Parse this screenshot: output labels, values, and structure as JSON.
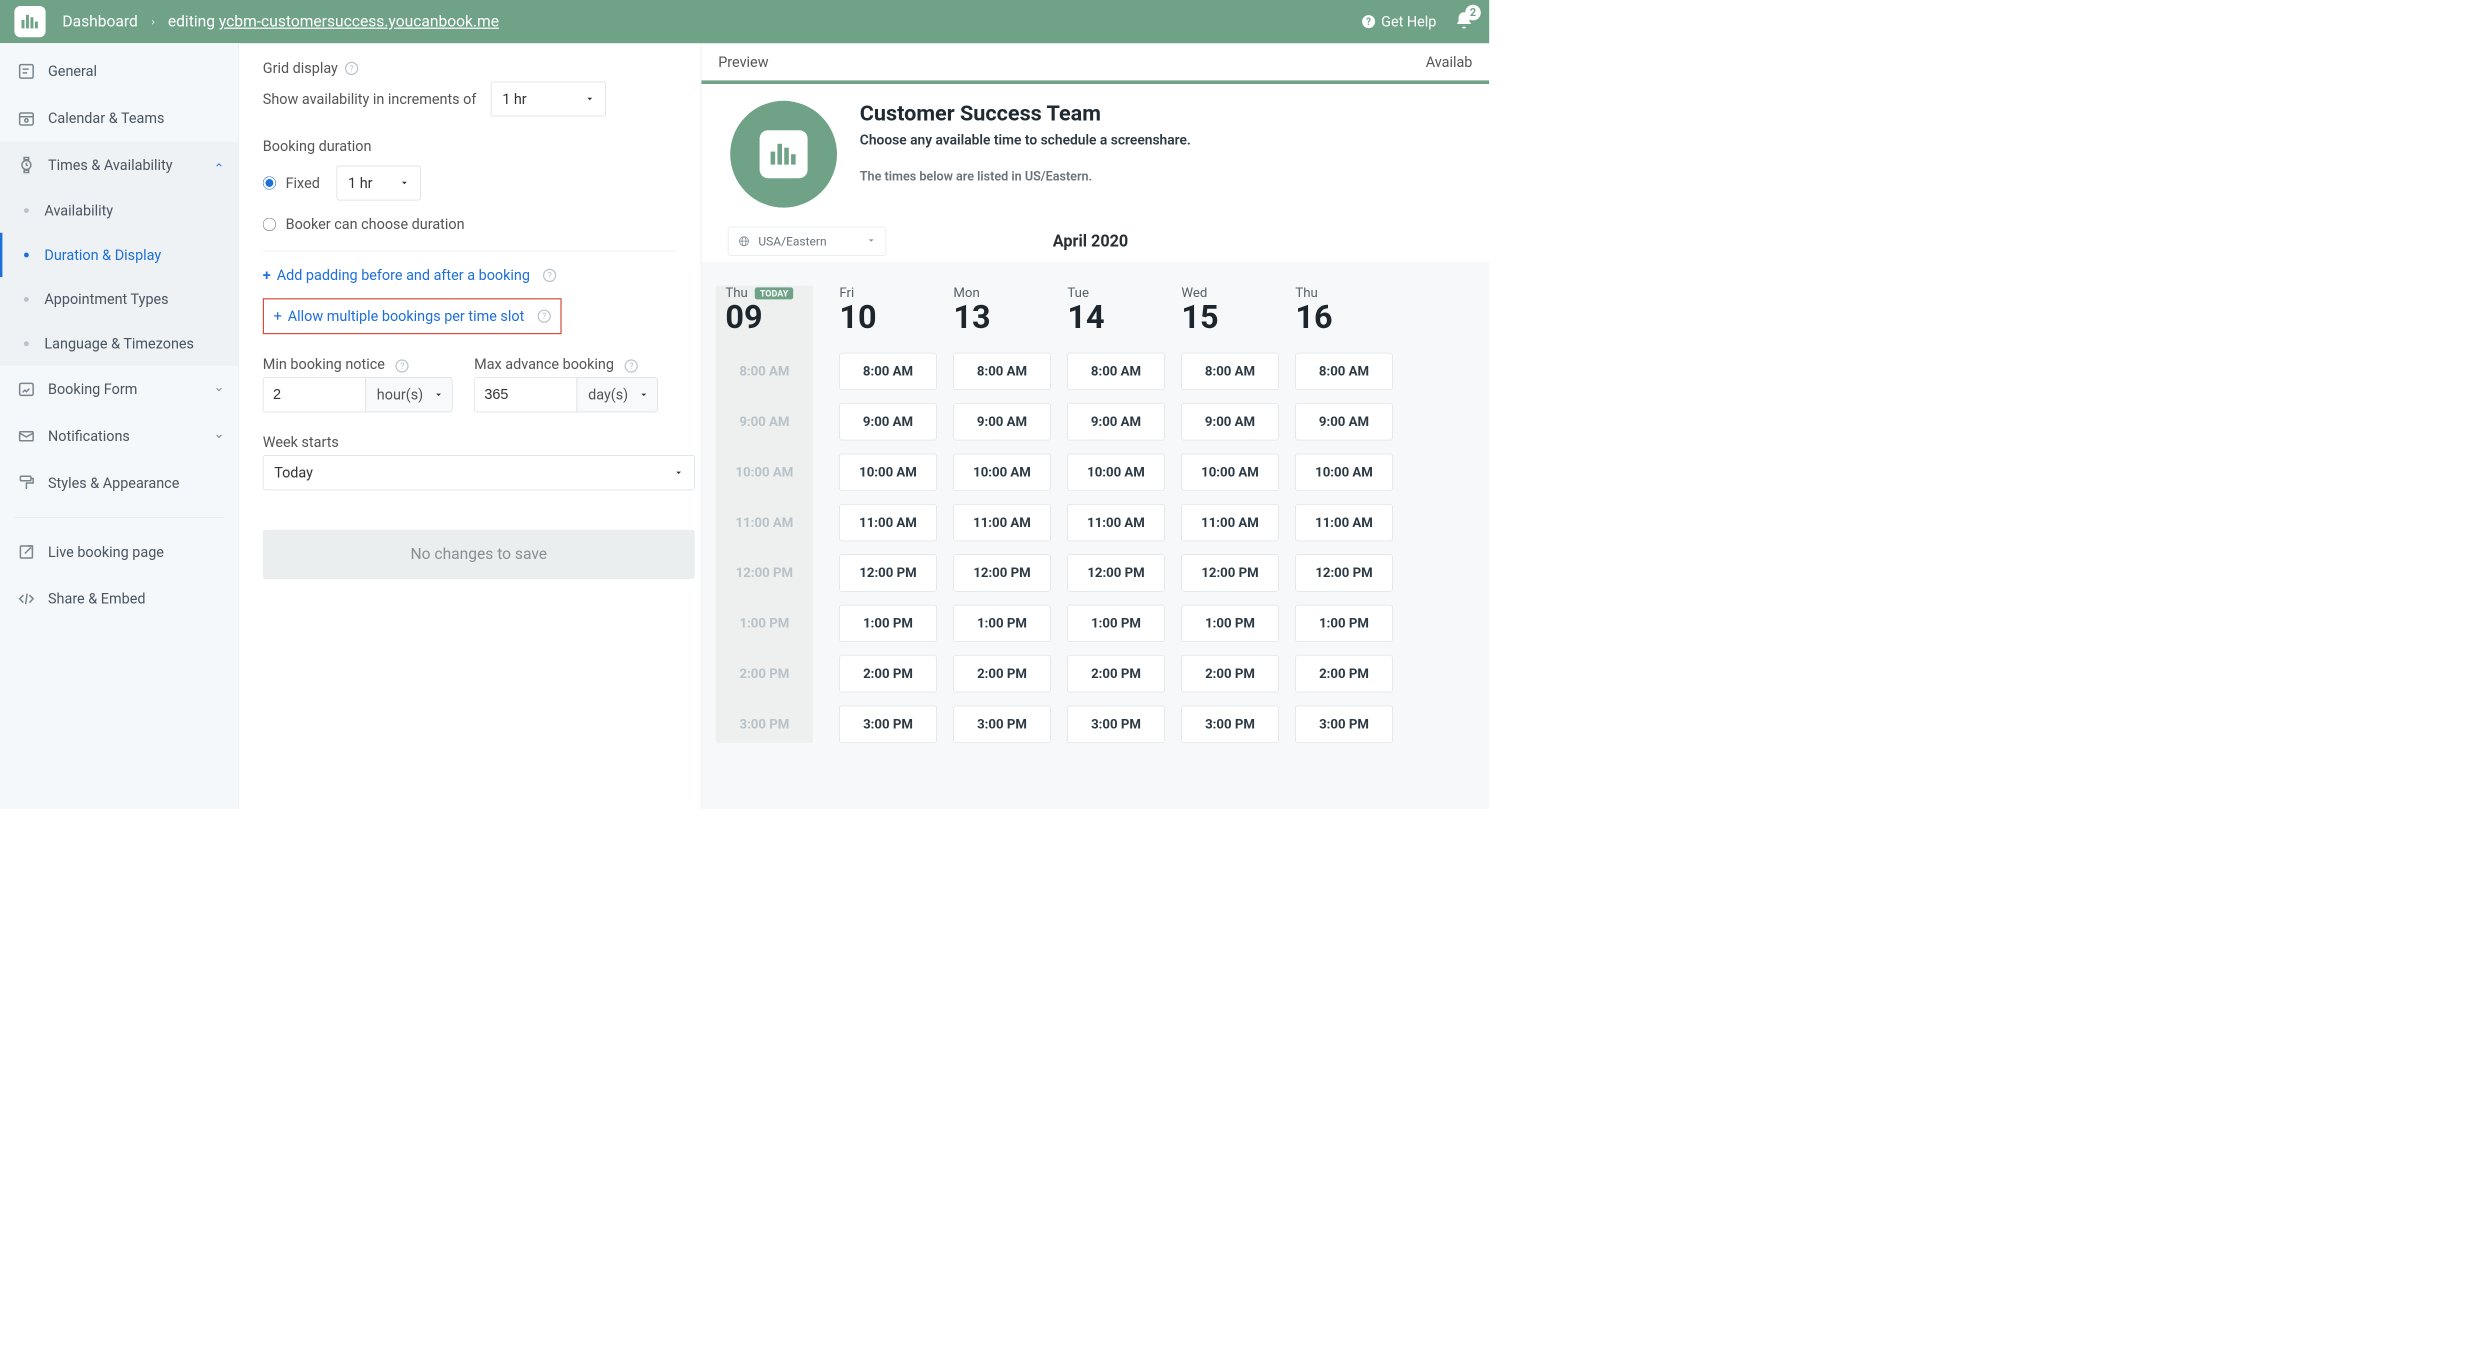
{
  "topbar": {
    "dashboard_label": "Dashboard",
    "editing_prefix": "editing ",
    "editing_url": "ycbm-customersuccess.youcanbook.me",
    "help_label": "Get Help",
    "notif_count": "2"
  },
  "sidebar": {
    "general": "General",
    "calendar_teams": "Calendar & Teams",
    "times_avail": "Times & Availability",
    "sub_availability": "Availability",
    "sub_duration": "Duration & Display",
    "sub_appt_types": "Appointment Types",
    "sub_lang_tz": "Language & Timezones",
    "booking_form": "Booking Form",
    "notifications": "Notifications",
    "styles": "Styles & Appearance",
    "live_page": "Live booking page",
    "share_embed": "Share & Embed"
  },
  "settings": {
    "grid_display": "Grid display",
    "show_incr_label": "Show availability in increments of",
    "show_incr_value": "1 hr",
    "booking_duration": "Booking duration",
    "fixed_label": "Fixed",
    "fixed_value": "1 hr",
    "booker_choose": "Booker can choose duration",
    "padding_link": "Add padding before and after a booking",
    "multi_link": "Allow multiple bookings per time slot",
    "min_notice_label": "Min booking notice",
    "min_notice_value": "2",
    "min_notice_unit": "hour(s)",
    "max_adv_label": "Max advance booking",
    "max_adv_value": "365",
    "max_adv_unit": "day(s)",
    "week_starts_label": "Week starts",
    "week_starts_value": "Today",
    "save_btn": "No changes to save"
  },
  "preview": {
    "preview_label": "Preview",
    "right_label": "Availab",
    "title": "Customer Success Team",
    "subtitle1": "Choose any available time to schedule a screenshare.",
    "subtitle2": "The times below are listed in US/Eastern.",
    "tz": "USA/Eastern",
    "month": "April 2020",
    "today_badge": "TODAY",
    "days": [
      {
        "dow": "Thu",
        "num": "09",
        "past": true
      },
      {
        "dow": "Fri",
        "num": "10",
        "past": false
      },
      {
        "dow": "Mon",
        "num": "13",
        "past": false
      },
      {
        "dow": "Tue",
        "num": "14",
        "past": false
      },
      {
        "dow": "Wed",
        "num": "15",
        "past": false
      },
      {
        "dow": "Thu",
        "num": "16",
        "past": false
      }
    ],
    "slots": [
      "8:00 AM",
      "9:00 AM",
      "10:00 AM",
      "11:00 AM",
      "12:00 PM",
      "1:00 PM",
      "2:00 PM",
      "3:00 PM"
    ]
  }
}
